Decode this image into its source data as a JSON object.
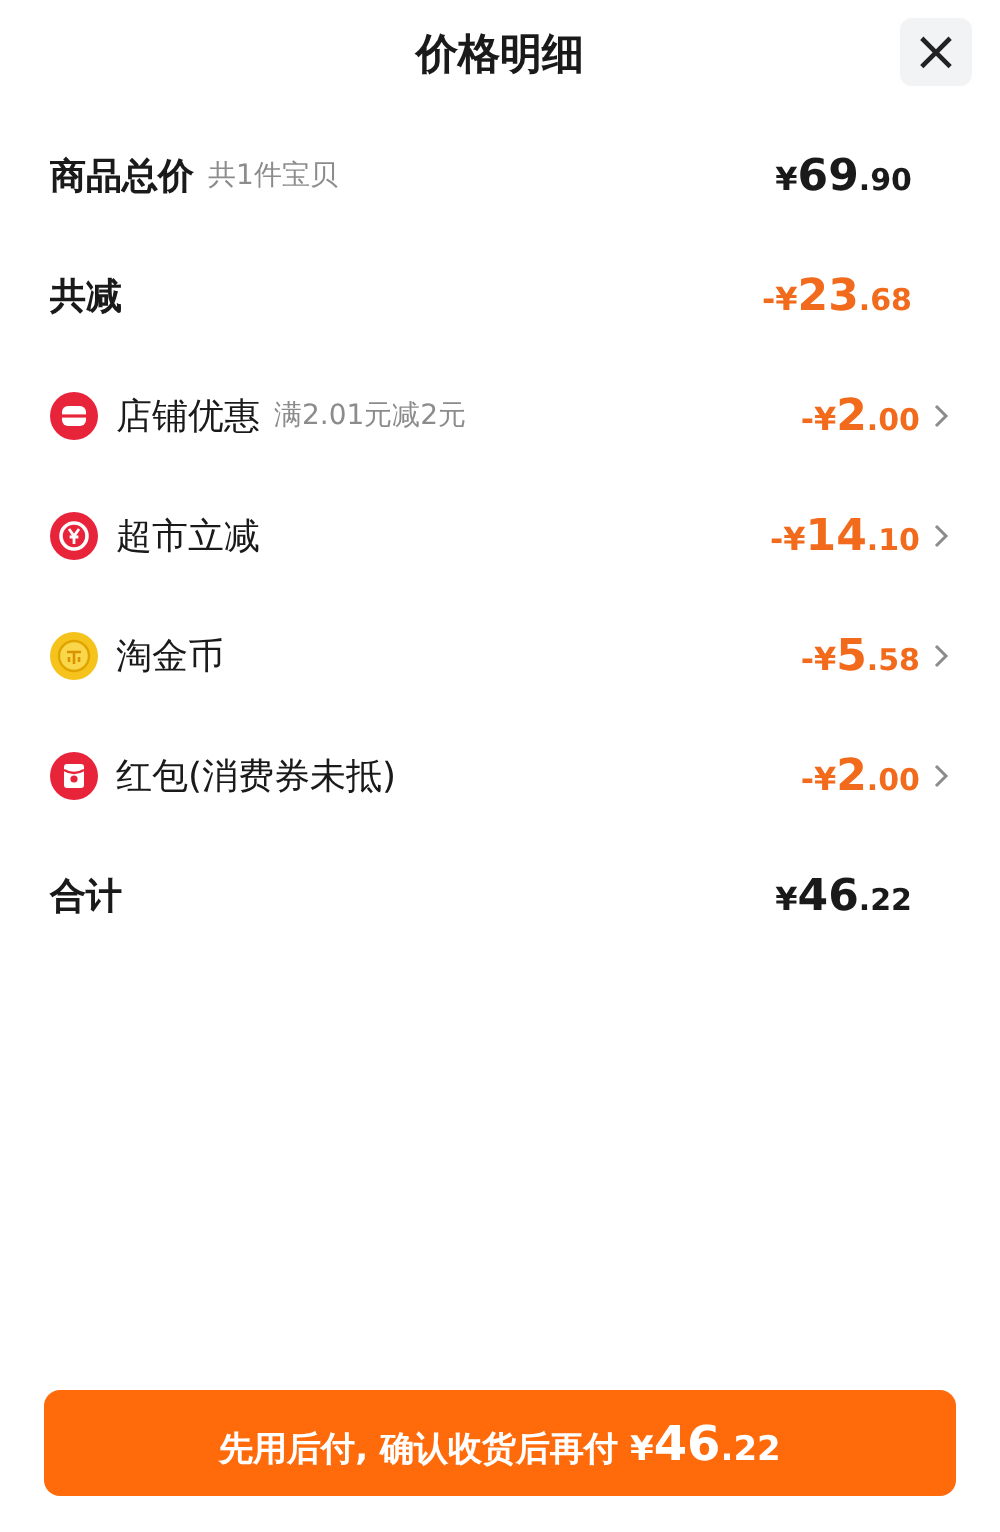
{
  "header": {
    "title": "价格明细",
    "close": "×"
  },
  "rows": [
    {
      "kind": "total",
      "label": "商品总价",
      "note": "共1件宝贝",
      "price": {
        "prefix": "¥",
        "whole": "69",
        "fraction": ".90"
      }
    },
    {
      "kind": "reduction",
      "label": "共减",
      "price": {
        "prefix": "-¥",
        "whole": "23",
        "fraction": ".68"
      }
    },
    {
      "kind": "discount",
      "label": "店铺优惠",
      "note": "满2.01元减2元",
      "price": {
        "prefix": "-¥",
        "whole": "2",
        "fraction": ".00"
      }
    },
    {
      "kind": "discount",
      "label": "超市立减",
      "price": {
        "prefix": "-¥",
        "whole": "14",
        "fraction": ".10"
      }
    },
    {
      "kind": "discount",
      "label": "淘金币",
      "price": {
        "prefix": "-¥",
        "whole": "5",
        "fraction": ".58"
      }
    },
    {
      "kind": "discount",
      "label": "红包(消费券未抵)",
      "price": {
        "prefix": "-¥",
        "whole": "2",
        "fraction": ".00"
      }
    },
    {
      "kind": "total",
      "label": "合计",
      "price": {
        "prefix": "¥",
        "whole": "46",
        "fraction": ".22"
      }
    }
  ],
  "pay_button": {
    "label": "先用后付, 确认收货后再付",
    "price": {
      "prefix": "¥",
      "whole": "46",
      "fraction": ".22"
    }
  }
}
